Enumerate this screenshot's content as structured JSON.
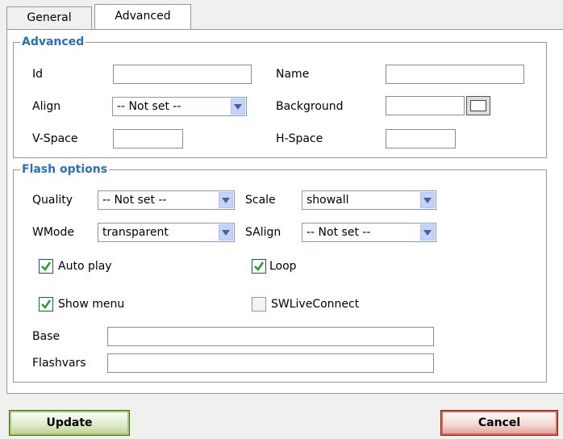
{
  "tabs": {
    "general": "General",
    "advanced": "Advanced"
  },
  "advanced": {
    "legend": "Advanced",
    "id_label": "Id",
    "id_value": "",
    "name_label": "Name",
    "name_value": "",
    "align_label": "Align",
    "align_value": "-- Not set --",
    "background_label": "Background",
    "background_value": "",
    "vspace_label": "V-Space",
    "vspace_value": "",
    "hspace_label": "H-Space",
    "hspace_value": ""
  },
  "flash": {
    "legend": "Flash options",
    "quality_label": "Quality",
    "quality_value": "-- Not set --",
    "scale_label": "Scale",
    "scale_value": "showall",
    "wmode_label": "WMode",
    "wmode_value": "transparent",
    "salign_label": "SAlign",
    "salign_value": "-- Not set --",
    "autoplay_label": "Auto play",
    "autoplay_checked": true,
    "loop_label": "Loop",
    "loop_checked": true,
    "showmenu_label": "Show menu",
    "showmenu_checked": true,
    "swlive_label": "SWLiveConnect",
    "swlive_checked": false,
    "base_label": "Base",
    "base_value": "",
    "flashvars_label": "Flashvars",
    "flashvars_value": ""
  },
  "buttons": {
    "update": "Update",
    "cancel": "Cancel"
  },
  "colors": {
    "legend": "#2b6fb6",
    "update_border": "#3b6a1a",
    "cancel_border": "#8a1a1a"
  }
}
